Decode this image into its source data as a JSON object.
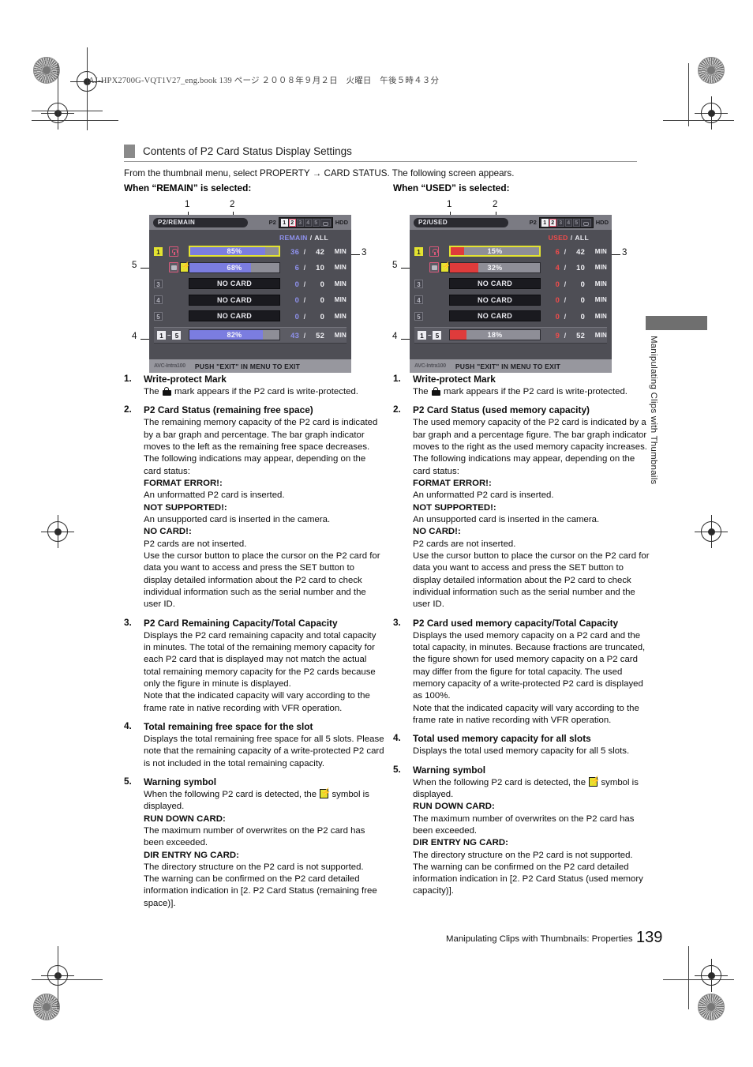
{
  "book_header": "AJ-HPX2700G-VQT1V27_eng.book   139 ページ   ２００８年９月２日　火曜日　午後５時４３分",
  "section": {
    "heading": "Contents of P2 Card Status Display Settings",
    "intro": "From the thumbnail menu, select PROPERTY → CARD STATUS. The following screen appears.",
    "when_remain": "When “REMAIN” is selected:",
    "when_used": "When “USED” is selected:"
  },
  "colors": {
    "remain_bar": "#7b7de0",
    "used_bar": "#df3b3b",
    "remain_key": "#8f92ee",
    "used_key": "#f04b4b",
    "cursor_yellow": "#e3e331",
    "lock_pink": "#d9587b",
    "screen_bg": "#4e4e55"
  },
  "callout_numbers": [
    "1",
    "2",
    "3",
    "4",
    "5"
  ],
  "screens": [
    {
      "mode_label": "P2/REMAIN",
      "p2_label": "P2",
      "hdd_label": "HDD",
      "slot_strip": [
        {
          "label": "1",
          "state": "on"
        },
        {
          "label": "2",
          "state": "active"
        },
        {
          "label": "3",
          "state": "off"
        },
        {
          "label": "4",
          "state": "off"
        },
        {
          "label": "5",
          "state": "off"
        },
        {
          "label": "",
          "state": "hdd"
        }
      ],
      "col_head": {
        "key": "REMAIN",
        "sep": "/",
        "all": "ALL"
      },
      "rows": [
        {
          "badge": "1",
          "badge_style": "cur",
          "icons": [
            "lock-icon"
          ],
          "bar_label": "85%",
          "bar_pct": 85,
          "selected": true,
          "no_card": false,
          "value": "36",
          "sep": "/",
          "total": "42",
          "unit": "MIN"
        },
        {
          "badge": "2",
          "badge_style": "prot",
          "icons": [
            "prot-icon",
            "warn-icon"
          ],
          "bar_label": "68%",
          "bar_pct": 68,
          "selected": false,
          "no_card": false,
          "value": "6",
          "sep": "/",
          "total": "10",
          "unit": "MIN"
        },
        {
          "badge": "3",
          "badge_style": "plain",
          "icons": [],
          "bar_label": "NO CARD",
          "bar_pct": 0,
          "selected": false,
          "no_card": true,
          "value": "0",
          "sep": "/",
          "total": "0",
          "unit": "MIN"
        },
        {
          "badge": "4",
          "badge_style": "plain",
          "icons": [],
          "bar_label": "NO CARD",
          "bar_pct": 0,
          "selected": false,
          "no_card": true,
          "value": "0",
          "sep": "/",
          "total": "0",
          "unit": "MIN"
        },
        {
          "badge": "5",
          "badge_style": "plain",
          "icons": [],
          "bar_label": "NO CARD",
          "bar_pct": 0,
          "selected": false,
          "no_card": true,
          "value": "0",
          "sep": "/",
          "total": "0",
          "unit": "MIN"
        }
      ],
      "total_row": {
        "from": "1",
        "dash": "–",
        "to": "5",
        "bar_label": "82%",
        "bar_pct": 82,
        "value": "43",
        "sep": "/",
        "total": "52",
        "unit": "MIN"
      },
      "footer": {
        "codec": "AVC-Intra100",
        "message": "PUSH \"EXIT\" IN MENU TO EXIT"
      }
    },
    {
      "mode_label": "P2/USED",
      "p2_label": "P2",
      "hdd_label": "HDD",
      "slot_strip": [
        {
          "label": "1",
          "state": "on"
        },
        {
          "label": "2",
          "state": "active"
        },
        {
          "label": "3",
          "state": "off"
        },
        {
          "label": "4",
          "state": "off"
        },
        {
          "label": "5",
          "state": "off"
        },
        {
          "label": "",
          "state": "hdd"
        }
      ],
      "col_head": {
        "key": "USED",
        "sep": "/",
        "all": "ALL"
      },
      "rows": [
        {
          "badge": "1",
          "badge_style": "cur",
          "icons": [
            "lock-icon"
          ],
          "bar_label": "15%",
          "bar_pct": 15,
          "selected": true,
          "no_card": false,
          "value": "6",
          "sep": "/",
          "total": "42",
          "unit": "MIN"
        },
        {
          "badge": "2",
          "badge_style": "prot",
          "icons": [
            "prot-icon",
            "warn-icon"
          ],
          "bar_label": "32%",
          "bar_pct": 32,
          "selected": false,
          "no_card": false,
          "value": "4",
          "sep": "/",
          "total": "10",
          "unit": "MIN"
        },
        {
          "badge": "3",
          "badge_style": "plain",
          "icons": [],
          "bar_label": "NO CARD",
          "bar_pct": 0,
          "selected": false,
          "no_card": true,
          "value": "0",
          "sep": "/",
          "total": "0",
          "unit": "MIN"
        },
        {
          "badge": "4",
          "badge_style": "plain",
          "icons": [],
          "bar_label": "NO CARD",
          "bar_pct": 0,
          "selected": false,
          "no_card": true,
          "value": "0",
          "sep": "/",
          "total": "0",
          "unit": "MIN"
        },
        {
          "badge": "5",
          "badge_style": "plain",
          "icons": [],
          "bar_label": "NO CARD",
          "bar_pct": 0,
          "selected": false,
          "no_card": true,
          "value": "0",
          "sep": "/",
          "total": "0",
          "unit": "MIN"
        }
      ],
      "total_row": {
        "from": "1",
        "dash": "–",
        "to": "5",
        "bar_label": "18%",
        "bar_pct": 18,
        "value": "9",
        "sep": "/",
        "total": "52",
        "unit": "MIN"
      },
      "footer": {
        "codec": "AVC-Intra100",
        "message": "PUSH \"EXIT\" IN MENU TO EXIT"
      }
    }
  ],
  "left_column": {
    "items": [
      {
        "n": "1.",
        "heading": "Write-protect Mark",
        "before_icon": "The",
        "after_icon": "mark appears if the P2 card is write-protected."
      },
      {
        "n": "2.",
        "heading": "P2 Card Status (remaining free space)",
        "p1": "The remaining memory capacity of the P2 card is indicated by a bar graph and percentage. The bar graph indicator moves to the left as the remaining free space decreases.",
        "p2": "The following indications may appear, depending on the card status:",
        "e1_head": "FORMAT ERROR!:",
        "e1_body": "An unformatted P2 card is inserted.",
        "e2_head": "NOT SUPPORTED!:",
        "e2_body": "An unsupported card is inserted in the camera.",
        "e3_head": "NO CARD!:",
        "e3_body": "P2 cards are not inserted.",
        "p3": "Use the cursor button to place the cursor on the P2 card for data you want to access and press the SET button to display detailed information about the P2 card to check individual information such as the serial number and the user ID."
      },
      {
        "n": "3.",
        "heading": "P2 Card Remaining Capacity/Total Capacity",
        "p1": "Displays the P2 card remaining capacity and total capacity in minutes. The total of the remaining memory capacity for each P2 card that is displayed may not match the actual total remaining memory capacity for the P2 cards because only the figure in minute is displayed.",
        "p2": "Note that the indicated capacity will vary according to the frame rate in native recording with VFR operation."
      },
      {
        "n": "4.",
        "heading": "Total remaining free space for the slot",
        "p1": "Displays the total remaining free space for all 5 slots. Please note that the remaining capacity of a write-protected P2 card is not included in the total remaining capacity."
      },
      {
        "n": "5.",
        "heading": "Warning symbol",
        "before_icon": "When the following P2 card is detected, the",
        "after_icon": "symbol is displayed.",
        "w1_head": "RUN DOWN CARD:",
        "w1_body": "The maximum number of overwrites on the P2 card has been exceeded.",
        "w2_head": "DIR ENTRY NG CARD:",
        "w2_body": "The directory structure on the P2 card is not supported.",
        "p_last": "The warning can be confirmed on the P2 card detailed information indication in [2. P2 Card Status (remaining free space)]."
      }
    ]
  },
  "right_column": {
    "items": [
      {
        "n": "1.",
        "heading": "Write-protect Mark",
        "before_icon": "The",
        "after_icon": "mark appears if the P2 card is write-protected."
      },
      {
        "n": "2.",
        "heading": "P2 Card Status (used memory capacity)",
        "p1": "The used memory capacity of the P2 card is indicated by a bar graph and a percentage figure. The bar graph indicator moves to the right as the used memory capacity increases.",
        "p2": "The following indications may appear, depending on the card status:",
        "e1_head": "FORMAT ERROR!:",
        "e1_body": "An unformatted P2 card is inserted.",
        "e2_head": "NOT SUPPORTED!:",
        "e2_body": "An unsupported card is inserted in the camera.",
        "e3_head": "NO CARD!:",
        "e3_body": "P2 cards are not inserted.",
        "p3": "Use the cursor button to place the cursor on the P2 card for data you want to access and press the SET button to display detailed information about the P2 card to check individual information such as the serial number and the user ID."
      },
      {
        "n": "3.",
        "heading": "P2 Card used memory capacity/Total Capacity",
        "p1": "Displays the used memory capacity on a P2 card and the total capacity, in minutes. Because fractions are truncated, the figure shown for used memory capacity on a P2 card may differ from the figure for total capacity. The used memory capacity of a write-protected P2 card is displayed as 100%.",
        "p2": "Note that the indicated capacity will vary according to the frame rate in native recording with VFR operation."
      },
      {
        "n": "4.",
        "heading": "Total used memory capacity for all slots",
        "p1": "Displays the total used memory capacity for all 5 slots."
      },
      {
        "n": "5.",
        "heading": "Warning symbol",
        "before_icon": "When the following P2 card is detected, the",
        "after_icon": "symbol is displayed.",
        "w1_head": "RUN DOWN CARD:",
        "w1_body": "The maximum number of overwrites on the P2 card has been exceeded.",
        "w2_head": "DIR ENTRY NG CARD:",
        "w2_body": "The directory structure on the P2 card is not supported.",
        "p_last": "The warning can be confirmed on the P2 card detailed information indication in [2. P2 Card Status (used memory capacity)]."
      }
    ]
  },
  "side_tab_text": "Manipulating Clips with Thumbnails",
  "footer": {
    "text": "Manipulating Clips with Thumbnails: Properties",
    "page": "139"
  }
}
